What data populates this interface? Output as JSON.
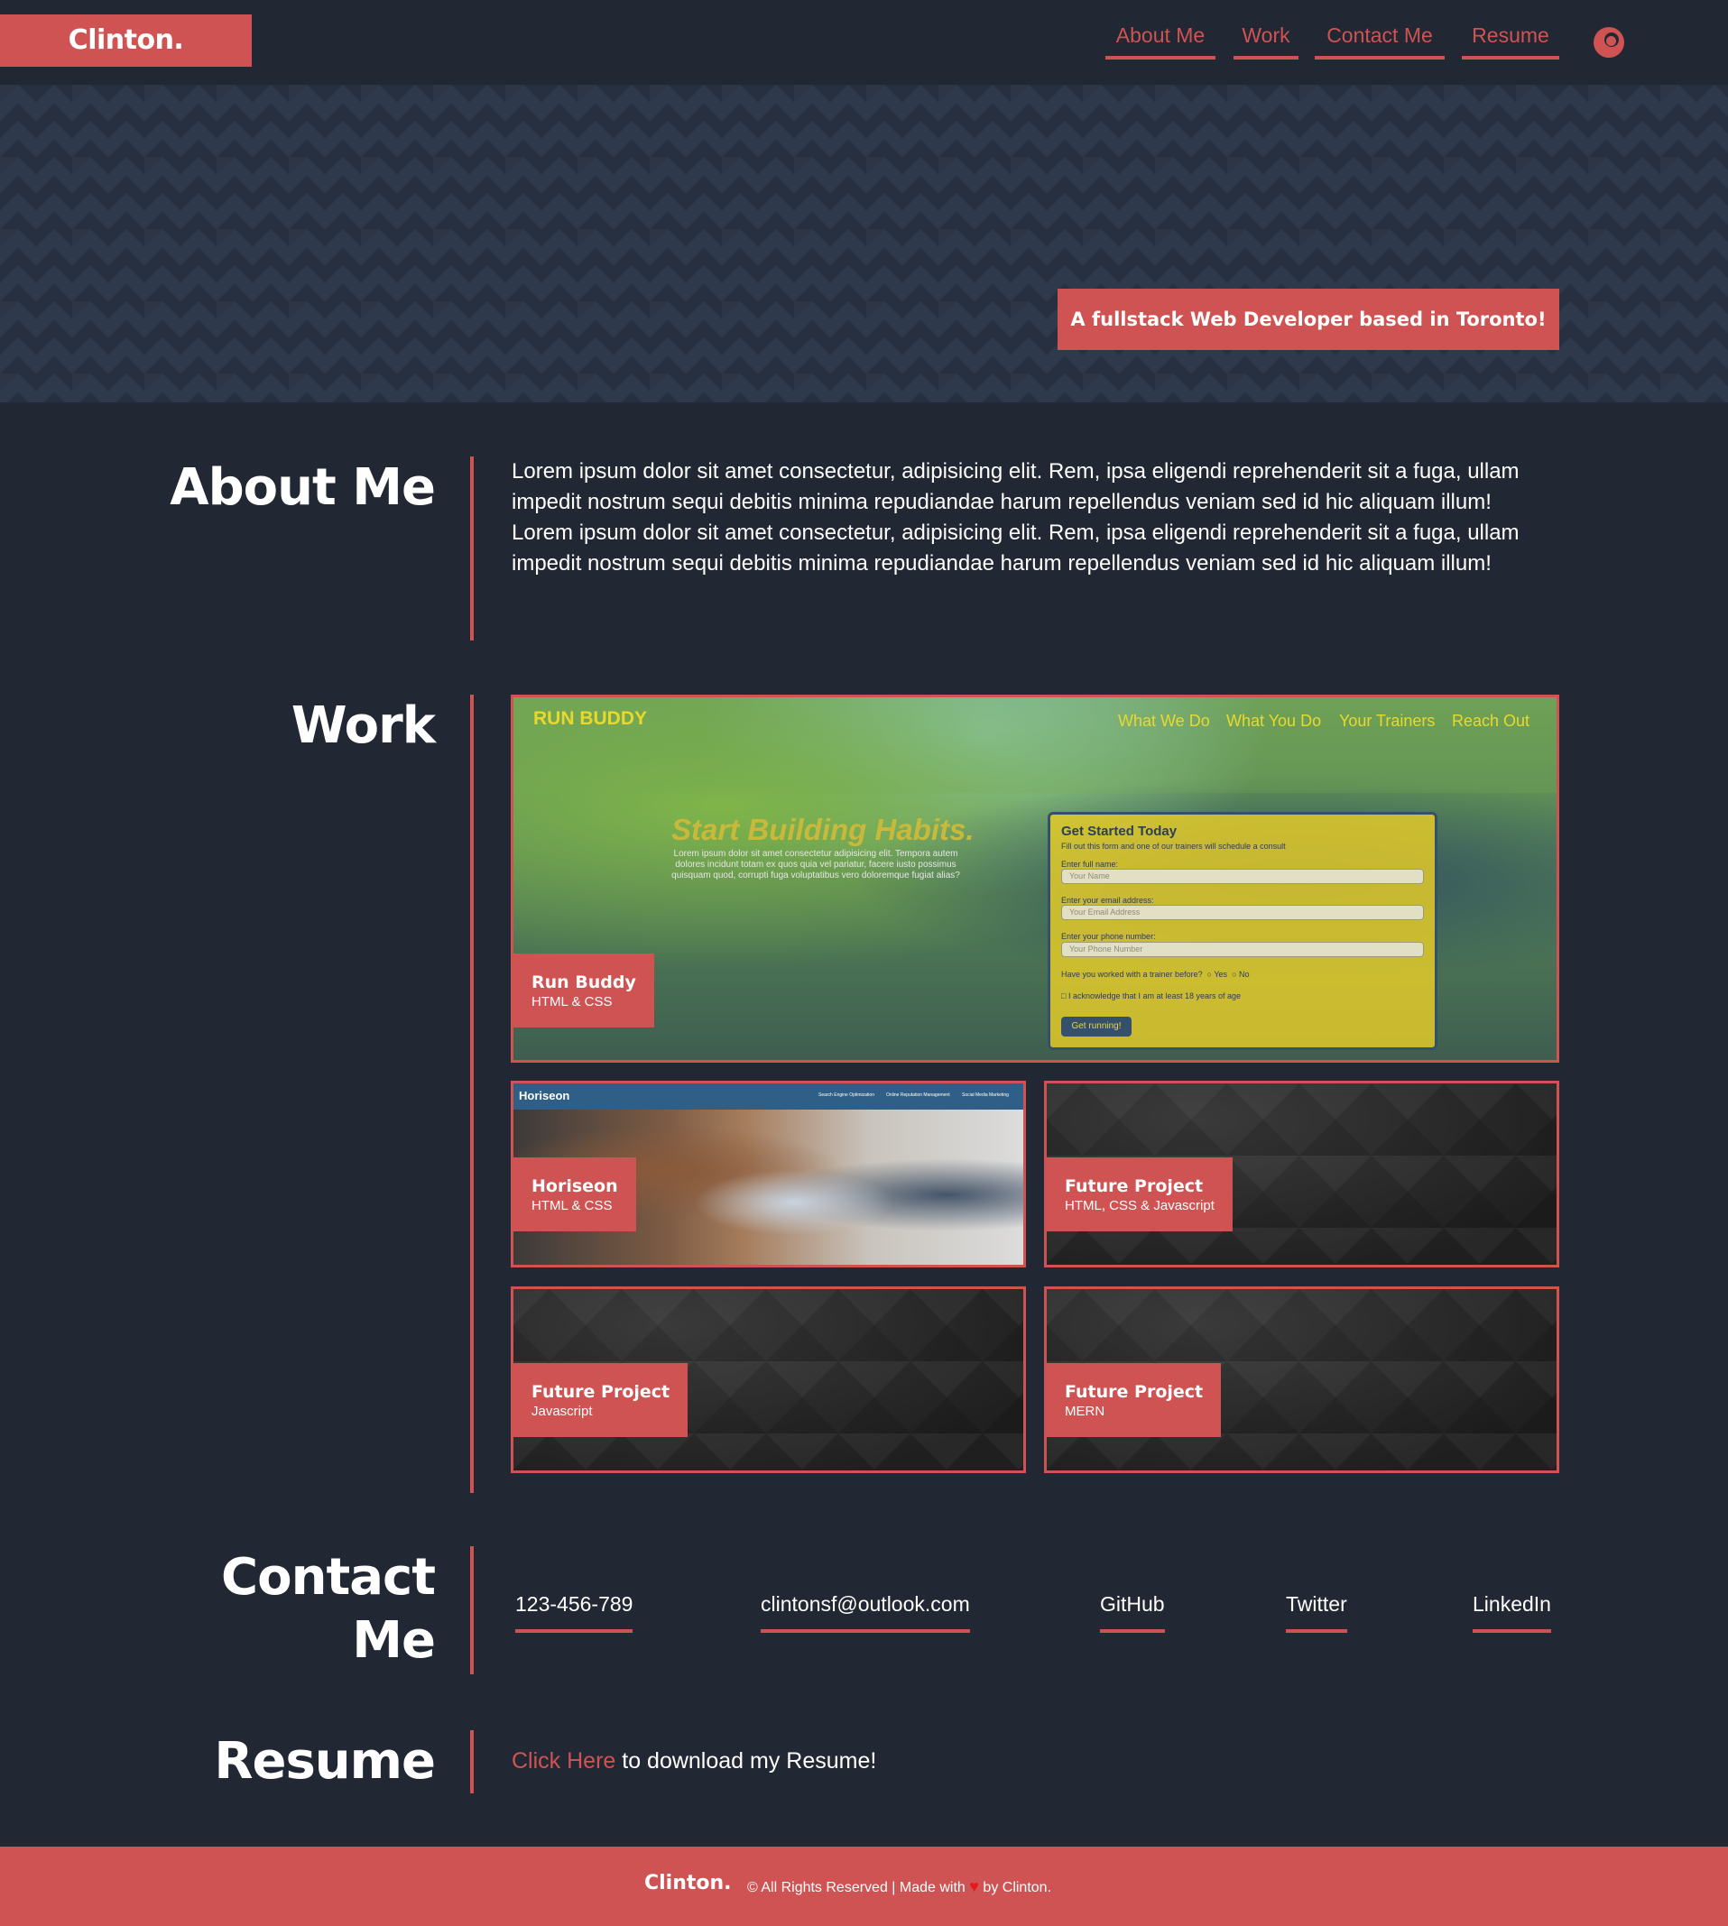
{
  "header": {
    "logo": "Clinton.",
    "nav": [
      {
        "label": "About Me"
      },
      {
        "label": "Work"
      },
      {
        "label": "Contact Me"
      },
      {
        "label": "Resume"
      }
    ],
    "theme_toggle_icon": "moon-icon"
  },
  "hero": {
    "tagline": "A fullstack Web Developer based in Toronto!"
  },
  "about": {
    "title": "About Me",
    "paragraph": "Lorem ipsum dolor sit amet consectetur, adipisicing elit. Rem, ipsa eligendi reprehenderit sit a fuga, ullam impedit nostrum sequi debitis minima repudiandae harum repellendus veniam sed id hic aliquam illum!",
    "paragraph2": "Lorem ipsum dolor sit amet consectetur, adipisicing elit. Rem, ipsa eligendi reprehenderit sit a fuga, ullam impedit nostrum sequi debitis minima repudiandae harum repellendus veniam sed id hic aliquam illum!"
  },
  "work": {
    "title": "Work",
    "projects": [
      {
        "title": "Run Buddy",
        "tech": "HTML & CSS"
      },
      {
        "title": "Horiseon",
        "tech": "HTML & CSS"
      },
      {
        "title": "Future Project",
        "tech": "HTML, CSS & Javascript"
      },
      {
        "title": "Future Project",
        "tech": "Javascript"
      },
      {
        "title": "Future Project",
        "tech": "MERN"
      }
    ],
    "run_buddy_preview": {
      "brand": "RUN BUDDY",
      "nav": [
        "What We Do",
        "What You Do",
        "Your Trainers",
        "Reach Out"
      ],
      "hero_title": "Start Building Habits.",
      "hero_text": "Lorem ipsum dolor sit amet consectetur adipisicing elit. Tempora autem dolores incidunt totam ex quos quia vel pariatur, facere iusto possimus quisquam quod, corrupti fuga voluptatibus vero doloremque fugiat alias?",
      "form_title": "Get Started Today",
      "form_subtitle": "Fill out this form and one of our trainers will schedule a consult",
      "label_name": "Enter full name:",
      "placeholder_name": "Your Name",
      "label_email": "Enter your email address:",
      "placeholder_email": "Your Email Address",
      "label_phone": "Enter your phone number:",
      "placeholder_phone": "Your Phone Number",
      "question": "Have you worked with a trainer before?",
      "yes": "Yes",
      "no": "No",
      "acknowledge": "I acknowledge that I am at least 18 years of age",
      "button": "Get running!"
    },
    "horiseon_preview": {
      "brand": "Horiseon",
      "nav": [
        "Search Engine Optimization",
        "Online Reputation Management",
        "Social Media Marketing"
      ]
    }
  },
  "contact": {
    "title_line1": "Contact",
    "title_line2": "Me",
    "links": [
      "123-456-789",
      "clintonsf@outlook.com",
      "GitHub",
      "Twitter",
      "LinkedIn"
    ]
  },
  "resume": {
    "title": "Resume",
    "link_text": "Click Here",
    "rest_text": " to download my Resume!"
  },
  "footer": {
    "logo": "Clinton.",
    "text_before": "© All Rights Reserved | Made with",
    "heart_icon": "heart-icon",
    "text_after": "by Clinton."
  },
  "colors": {
    "accent": "#d05353",
    "background": "#222833",
    "hero_pattern": "#2e3a4c"
  }
}
